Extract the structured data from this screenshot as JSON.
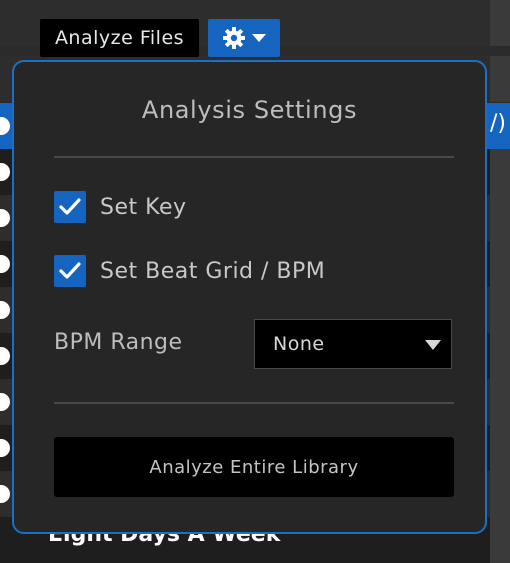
{
  "toolbar": {
    "analyze_files_label": "Analyze Files",
    "settings_icon": "gear-icon",
    "dropdown_icon": "caret-down-icon"
  },
  "popup": {
    "title": "Analysis Settings",
    "set_key": {
      "label": "Set Key",
      "checked": true
    },
    "set_beat_grid": {
      "label": "Set Beat Grid / BPM",
      "checked": true
    },
    "bpm_range": {
      "label": "BPM Range",
      "selected": "None"
    },
    "analyze_library_label": "Analyze Entire Library"
  },
  "background": {
    "selected_row_edge_text": "/)",
    "bottom_track_title": "Eight Days A Week"
  },
  "colors": {
    "accent": "#1565c0",
    "popup_bg": "#262626",
    "button_bg": "#000000"
  }
}
